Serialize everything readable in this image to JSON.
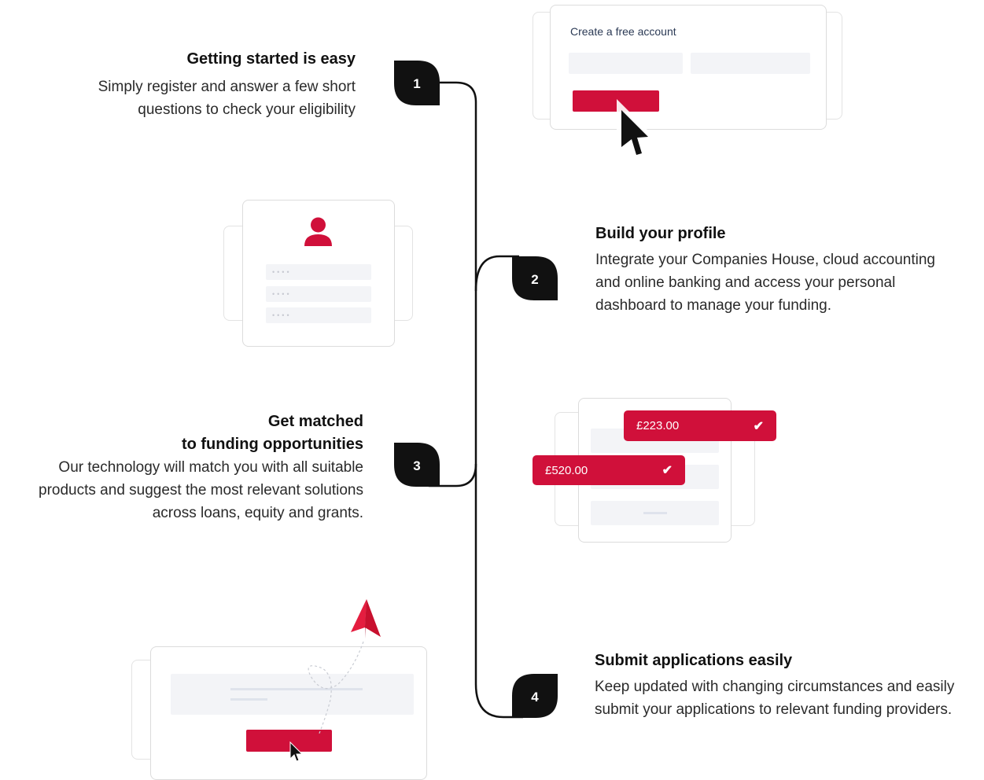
{
  "steps": [
    {
      "number": "1",
      "title": "Getting started is easy",
      "desc_lines": [
        "Simply register and answer a few short",
        "questions to check your eligibility"
      ]
    },
    {
      "number": "2",
      "title": "Build your profile",
      "desc_lines": [
        "Integrate your Companies House, cloud accounting",
        "and online banking and access your personal",
        "dashboard to manage your funding."
      ]
    },
    {
      "number": "3",
      "title_lines": [
        "Get matched",
        "to funding opportunities"
      ],
      "desc_lines": [
        "Our technology will match you with all suitable",
        "products and suggest the most relevant solutions",
        "across loans, equity and grants."
      ]
    },
    {
      "number": "4",
      "title": "Submit applications easily",
      "desc_lines": [
        "Keep updated with changing circumstances and easily",
        "submit your applications to relevant funding providers."
      ]
    }
  ],
  "signup_card": {
    "heading": "Create a free account"
  },
  "profile_card": {
    "placeholder_rows": [
      "••••",
      "••••",
      "••••"
    ]
  },
  "match_card": {
    "amounts": [
      "£223.00",
      "£520.00"
    ]
  },
  "colors": {
    "accent": "#d0103a",
    "line": "#111111",
    "placeholder": "#f3f4f7"
  },
  "icons": [
    "user-icon",
    "cursor-icon",
    "check-icon",
    "paper-plane-icon"
  ]
}
